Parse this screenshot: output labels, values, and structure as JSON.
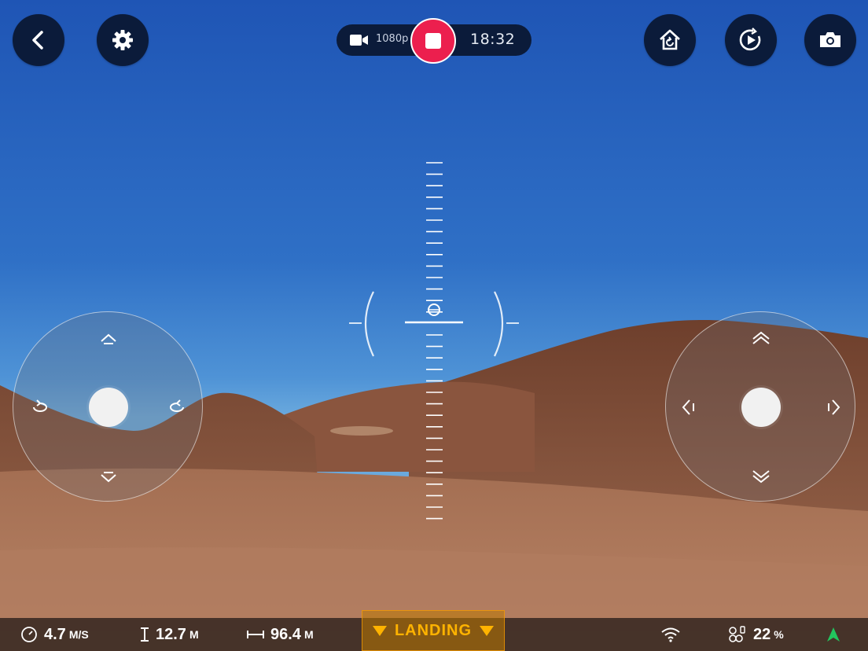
{
  "top_bar": {
    "back_button": "back",
    "settings_button": "settings",
    "recording": {
      "resolution": "1080p",
      "elapsed": "18:32"
    },
    "return_home_button": "return-home",
    "play_button": "play",
    "photo_button": "photo"
  },
  "telemetry": {
    "speed_value": "4.7",
    "speed_unit": "M/S",
    "altitude_value": "12.7",
    "altitude_unit": "M",
    "distance_value": "96.4",
    "distance_unit": "M",
    "battery_value": "22",
    "battery_unit": "%"
  },
  "status": {
    "mode_label": "LANDING"
  },
  "colors": {
    "button_bg": "#0b1b3a",
    "record_red": "#ec1f4e",
    "landing_amber": "#ffb300",
    "gps_green": "#22c55e"
  },
  "icons": {
    "back": "chevron-left-icon",
    "settings": "gear-icon",
    "video": "video-camera-icon",
    "record": "stop-square-icon",
    "home": "home-return-icon",
    "play": "play-circle-icon",
    "photo": "camera-icon",
    "speed": "speedometer-icon",
    "altitude": "altitude-icon",
    "distance": "distance-icon",
    "wifi": "wifi-icon",
    "drone_battery": "drone-battery-icon",
    "gps": "gps-arrow-icon"
  }
}
